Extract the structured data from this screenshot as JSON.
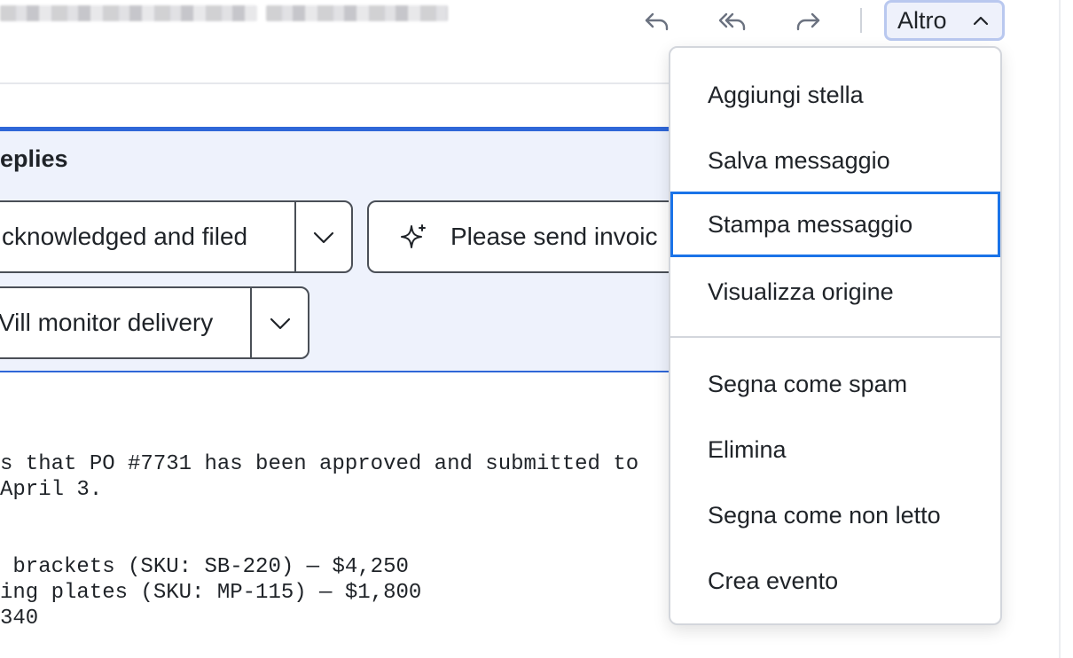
{
  "toolbar": {
    "more_label": "Altro"
  },
  "smart_replies": {
    "title": "eplies",
    "reply_1": "cknowledged and filed",
    "reply_2": "Please send invoic",
    "reply_3": "Vill monitor delivery"
  },
  "message": {
    "line_1": "s that PO #7731 has been approved and submitted to",
    "line_2": "April 3.",
    "line_3": " brackets (SKU: SB-220) — $4,250",
    "line_4": "ing plates (SKU: MP-115) — $1,800",
    "line_5": "340"
  },
  "menu": {
    "items": [
      "Aggiungi stella",
      "Salva messaggio",
      "Stampa messaggio",
      "Visualizza origine",
      "Segna come spam",
      "Elimina",
      "Segna come non letto",
      "Crea evento"
    ],
    "focused_index": 2
  },
  "colors": {
    "accent": "#1a73e8",
    "panel_border": "#2f67d8",
    "panel_bg": "#eef2fc"
  },
  "icons": {
    "reply": "reply-icon",
    "reply_all": "reply-all-icon",
    "forward": "forward-icon",
    "chevron_up": "chevron-up-icon",
    "chevron_down": "chevron-down-icon",
    "sparkle": "sparkle-icon"
  }
}
